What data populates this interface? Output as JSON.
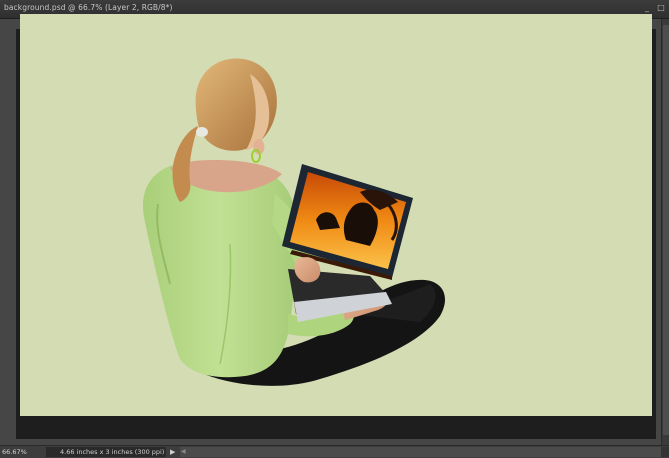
{
  "window": {
    "title": "background.psd @ 66.7% (Layer 2, RGB/8*)"
  },
  "window_controls": {
    "minimize": "_",
    "restore": "□"
  },
  "canvas": {
    "background": "#d3dcb3"
  },
  "status": {
    "zoom": "66.67%",
    "doc_info": "4.66 inches x 3 inches (300 ppi)",
    "menu_arrow": "▶",
    "scroll_left": "◀"
  },
  "colors": {
    "top": "#b7d888",
    "pants": "#121212",
    "laptop_screen": "#f08a14",
    "hair": "#c89558"
  }
}
